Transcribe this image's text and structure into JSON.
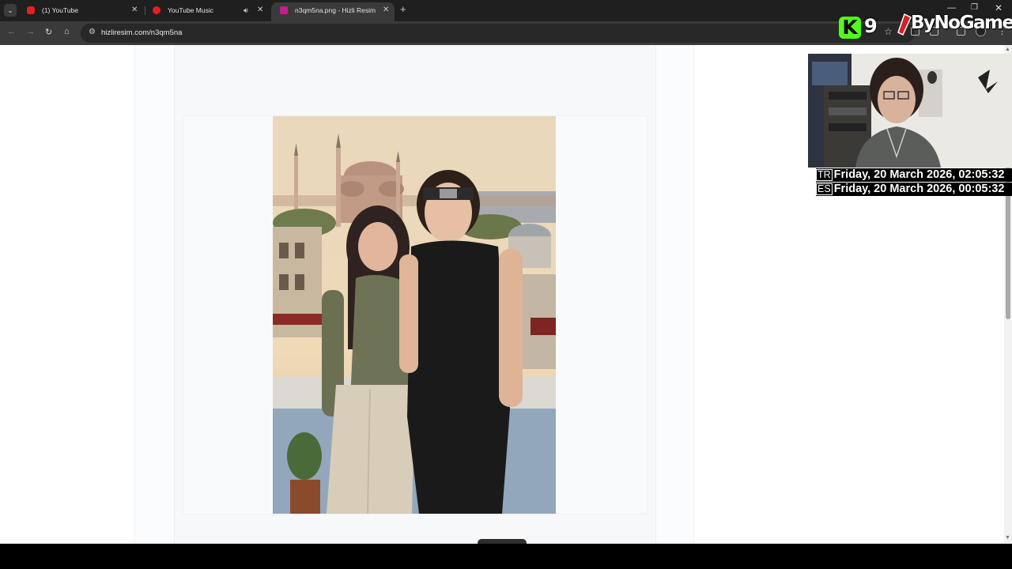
{
  "browser": {
    "tabs": [
      {
        "title": "(1) YouTube",
        "favicon": "youtube-icon"
      },
      {
        "title": "YouTube Music",
        "favicon": "youtube-music-icon",
        "audio": true
      },
      {
        "title": "n3qm5na.png - Hizli Resim",
        "favicon": "hizliresim-icon",
        "active": true
      }
    ],
    "url": "hizliresim.com/n3qm5na"
  },
  "overlay": {
    "kick_viewers": "9",
    "streamer_name": "ByNoGame",
    "clocks": [
      {
        "flag": "TR",
        "time": "Friday, 20 March 2026, 02:05:32"
      },
      {
        "flag": "ES",
        "time": "Friday, 20 March 2026, 00:05:32"
      }
    ]
  },
  "colors": {
    "kick_green": "#53fc18",
    "chrome_dark": "#1f1f1f",
    "toolbar": "#3a3a3a",
    "page_bg": "#ffffff"
  }
}
